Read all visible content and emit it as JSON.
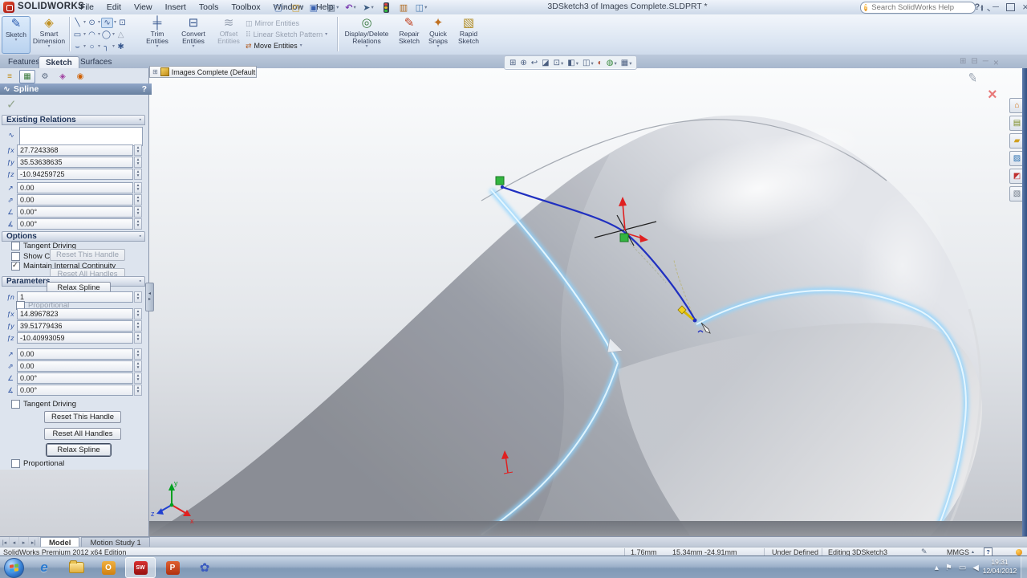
{
  "window": {
    "brand": "SOLIDWORKS",
    "title": "3DSketch3 of Images Complete.SLDPRT *",
    "search_placeholder": "Search SolidWorks Help",
    "help_q": "?"
  },
  "menus": [
    "File",
    "Edit",
    "View",
    "Insert",
    "Tools",
    "Toolbox",
    "Window",
    "Help"
  ],
  "toolbar": {
    "sketch": "Sketch",
    "smart_dimension": "Smart Dimension",
    "trim": "Trim Entities",
    "convert": "Convert Entities",
    "offset": "Offset Entities",
    "mirror": "Mirror Entities",
    "linear_pattern": "Linear Sketch Pattern",
    "move": "Move Entities",
    "display_delete": "Display/Delete Relations",
    "repair": "Repair Sketch",
    "quick_snaps": "Quick Snaps",
    "rapid": "Rapid Sketch"
  },
  "tabs": {
    "features": "Features",
    "sketch": "Sketch",
    "surfaces": "Surfaces"
  },
  "doc_tab": {
    "label": "Images Complete  (Default..."
  },
  "pm": {
    "title": "Spline",
    "help": "?",
    "relations_header": "Existing Relations",
    "options_header": "Options",
    "parameters_header": "Parameters",
    "rel": {
      "x": "27.7243368",
      "y": "35.53638635",
      "z": "-10.94259725",
      "t1": "0.00",
      "t2": "0.00",
      "a1": "0.00°",
      "a2": "0.00°"
    },
    "opt": {
      "tangent": "Tangent Driving",
      "show_curvature": "Show Cu",
      "maintain": "Maintain Internal Continuity"
    },
    "btns": {
      "reset_this": "Reset This Handle",
      "reset_all": "Reset All Handles",
      "relax": "Relax Spline"
    },
    "par": {
      "n": "1",
      "proportional": "Proportional",
      "x": "14.8967823",
      "y": "39.51779436",
      "z": "-10.40993059",
      "t1": "0.00",
      "t2": "0.00",
      "a1": "0.00°",
      "a2": "0.00°",
      "tangent": "Tangent Driving"
    }
  },
  "viewport": {
    "triad": {
      "x": "x",
      "y": "y",
      "z": "z"
    }
  },
  "bottom_tabs": {
    "model": "Model",
    "motion": "Motion Study 1"
  },
  "status": {
    "product": "SolidWorks Premium 2012 x64 Edition",
    "measure": "1.76mm",
    "coords": "15.34mm -24.91mm",
    "state": "Under Defined",
    "editing": "Editing 3DSketch3",
    "units": "MMGS",
    "help": "?"
  },
  "taskbar": {
    "time": "19:31",
    "date": "12/04/2012"
  },
  "colors": {
    "accent_blue": "#2030c0",
    "glow_blue": "#9fd8ff",
    "handle_green": "#33b540",
    "arrow_red": "#e02020",
    "sw_red": "#c02020"
  },
  "icons": {
    "dropdown": "▾",
    "spinup": "▴",
    "spindn": "▾",
    "new": "▢",
    "open": "◰",
    "save": "▣",
    "print": "▤",
    "undo": "↶",
    "select": "➤",
    "clipboard": "▥",
    "window": "◫",
    "min": "─",
    "close": "×",
    "zoomfit": "⊞",
    "zoomarea": "⊕",
    "prevview": "↩",
    "section": "◪",
    "orient": "⊡",
    "dstyle": "◧",
    "hideshow": "◫",
    "appearance": "◐",
    "scene": "◍",
    "vsettings": "▦",
    "wnew": "⊞",
    "wcascade": "⊟",
    "pencil": "✎",
    "tp_home": "⌂",
    "tp_lib": "▤",
    "tp_folder": "▰",
    "tp_view": "▨",
    "tp_app": "◩",
    "tp_prop": "▧",
    "fm": "≡",
    "pmtab": "▦",
    "cfg": "⚙",
    "dimx": "◈",
    "dispm": "◉",
    "splineglyph": "∿",
    "fx": "ƒx",
    "fy": "ƒy",
    "fz": "ƒz",
    "fn": "ƒn",
    "tan": "↗",
    "tan2": "⇗",
    "ang": "∠",
    "ang2": "∡",
    "crv": "◡",
    "tool_line": "╲",
    "tool_circle": "⊙",
    "tool_spline": "∿",
    "tool_pt": "⊡",
    "tool_rect": "▭",
    "tool_arc": "◠",
    "tool_ellipse": "◯",
    "tool_tri": "△",
    "tool_smile": "⌣",
    "tool_c2": "○",
    "tool_fillet": "╮",
    "tool_star": "✱",
    "trim": "╪",
    "convert": "⊟",
    "offset": "≋",
    "mirror": "◫",
    "pattern": "⠿",
    "move": "⇄",
    "ddrel": "◎",
    "qsnap": "✦",
    "rapid": "▧",
    "smartdim": "◈",
    "sketchpen": "✎",
    "nav1": "|◂",
    "nav2": "◂",
    "nav3": "▸",
    "nav4": "▸|",
    "tray_up": "▴",
    "tray_flag": "⚑",
    "tray_disp": "▭",
    "tray_vol": "◀",
    "ie": "e",
    "sw": "SW",
    "ppt": "P",
    "outlook": "O",
    "flower": "✿",
    "grip": "◂▸",
    "expand": "⊞"
  }
}
